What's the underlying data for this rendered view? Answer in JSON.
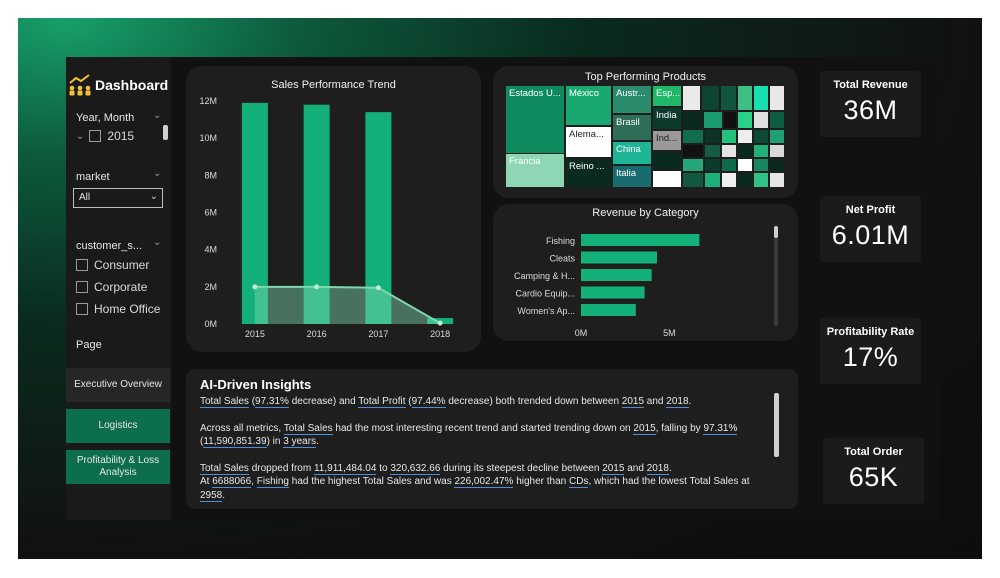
{
  "sidebar": {
    "title": "Dashboard",
    "year_slicer": {
      "title": "Year, Month",
      "value": "2015"
    },
    "market_slicer": {
      "title": "market",
      "selected": "All"
    },
    "segment_slicer": {
      "title": "customer_s...",
      "options": [
        "Consumer",
        "Corporate",
        "Home Office"
      ]
    },
    "page_label": "Page",
    "nav": [
      "Executive Overview",
      "Logistics",
      "Profitability & Loss Analysis"
    ]
  },
  "sales_trend": {
    "title": "Sales Performance Trend",
    "chart_data": {
      "type": "bar",
      "categories": [
        "2015",
        "2016",
        "2017",
        "2018"
      ],
      "series": [
        {
          "type": "bar",
          "values": [
            11.9,
            11.8,
            11.4,
            0.32
          ]
        },
        {
          "type": "area",
          "values": [
            2.0,
            2.0,
            1.95,
            0.05
          ]
        }
      ],
      "ylim": [
        0,
        12
      ],
      "yticks": [
        "0M",
        "2M",
        "4M",
        "6M",
        "8M",
        "10M",
        "12M"
      ],
      "colors": {
        "bar": "#14b07a",
        "area": "#7fd6b0"
      }
    }
  },
  "top_products": {
    "title": "Top Performing Products",
    "labels": [
      "Estados U...",
      "México",
      "Austr...",
      "Esp...",
      "Francia",
      "Alema...",
      "Brasil",
      "India",
      "Reino ...",
      "China",
      "Ind...",
      "Italia"
    ]
  },
  "revenue_by_category": {
    "title": "Revenue by Category",
    "chart_data": {
      "type": "bar",
      "orientation": "horizontal",
      "categories": [
        "Fishing",
        "Cleats",
        "Camping & H...",
        "Cardio Equip...",
        "Women's Ap..."
      ],
      "values": [
        6.7,
        4.3,
        4.0,
        3.6,
        3.1
      ],
      "xticks": [
        "0M",
        "5M"
      ],
      "xlim": [
        0,
        10.3
      ],
      "color": "#14b07a"
    }
  },
  "kpis": [
    {
      "title": "Total Revenue",
      "value": "36M"
    },
    {
      "title": "Net Profit",
      "value": "6.01M"
    },
    {
      "title": "Profitability Rate",
      "value": "17%"
    },
    {
      "title": "Total Order",
      "value": "65K"
    }
  ],
  "insights": {
    "title": "AI-Driven Insights",
    "p1": {
      "a": "Total Sales",
      "b": " (",
      "c": "97.31%",
      "d": " decrease) and ",
      "e": "Total Profit",
      "f": " (",
      "g": "97.44%",
      "h": " decrease) both trended down between ",
      "i": "2015",
      "j": " and ",
      "k": "2018",
      "l": "."
    },
    "p2": {
      "a": "Across all metrics, ",
      "b": "Total Sales",
      "c": " had the most interesting recent trend and started trending down on ",
      "d": "2015",
      "e": ", falling by ",
      "f": "97.31%",
      "g": " (",
      "h": "11,590,851.39",
      "i": ") in ",
      "j": "3 years",
      "k": "."
    },
    "p3": {
      "a": "Total Sales",
      "b": " dropped from ",
      "c": "11,911,484.04",
      "d": " to ",
      "e": "320,632.66",
      "f": " during its steepest decline between ",
      "g": "2015",
      "h": " and ",
      "i": "2018",
      "j": "."
    },
    "p4": {
      "a": "At ",
      "b": "6688066",
      "c": ", ",
      "d": "Fishing",
      "e": " had the highest Total Sales and was ",
      "f": "226,002.47%",
      "g": " higher than ",
      "h": "CDs",
      "i": ", which had the lowest Total Sales at ",
      "j": "2958",
      "k": "."
    }
  }
}
